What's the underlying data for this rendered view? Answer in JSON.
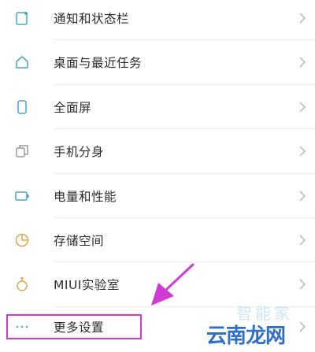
{
  "settings_list": {
    "items": [
      {
        "label": "通知和状态栏"
      },
      {
        "label": "桌面与最近任务"
      },
      {
        "label": "全面屏"
      },
      {
        "label": "手机分身"
      },
      {
        "label": "电量和性能"
      },
      {
        "label": "存储空间"
      },
      {
        "label": "MIUI实验室"
      },
      {
        "label": "更多设置"
      }
    ]
  },
  "watermark": {
    "top_text": "智能家",
    "bottom_text": "云南龙网"
  },
  "colors": {
    "icon_accent": "#4aa6c9",
    "highlight": "#d23bd2",
    "watermark_blue": "#2f6fc8"
  }
}
